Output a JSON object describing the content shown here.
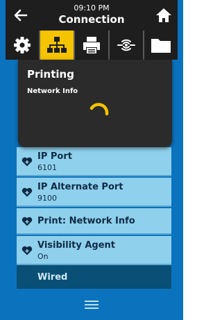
{
  "header": {
    "time": "09:10 PM",
    "title": "Connection",
    "back_icon": "arrow-left-icon",
    "home_icon": "home-icon"
  },
  "tabs": [
    {
      "icon": "gear-icon",
      "active": false
    },
    {
      "icon": "network-icon",
      "active": true
    },
    {
      "icon": "printer-icon",
      "active": false
    },
    {
      "icon": "wireless-icon",
      "active": false
    },
    {
      "icon": "folder-icon",
      "active": false
    }
  ],
  "dialog": {
    "title": "Printing",
    "subtitle": "Network Info",
    "spinner_icon": "loading-spinner-icon"
  },
  "items": [
    {
      "label": "IP Port",
      "value": "6101"
    },
    {
      "label": "IP Alternate Port",
      "value": "9100"
    },
    {
      "label": "Print: Network Info",
      "value": ""
    },
    {
      "label": "Visibility Agent",
      "value": "On"
    }
  ],
  "section": {
    "label": "Wired"
  },
  "footer": {
    "menu_icon": "hamburger-menu-icon"
  },
  "colors": {
    "background": "#0b73be",
    "bar": "#1e1e1e",
    "active_tab": "#f5c300",
    "list_item": "#8fd0ec",
    "section": "#0a4f75",
    "spinner": "#f5c300"
  }
}
